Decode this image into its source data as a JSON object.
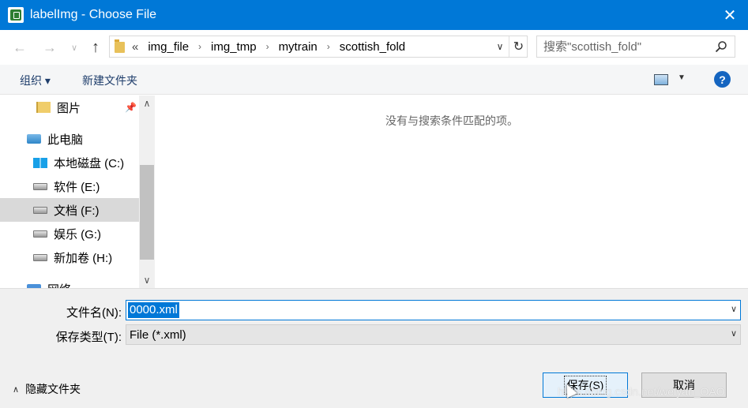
{
  "window": {
    "title": "labelImg - Choose File",
    "close_glyph": "✕"
  },
  "nav": {
    "back_glyph": "←",
    "forward_glyph": "→",
    "recent_glyph": "∨",
    "up_glyph": "↑",
    "overflow": "«",
    "breadcrumbs": [
      "img_file",
      "img_tmp",
      "mytrain",
      "scottish_fold"
    ],
    "separator": "›",
    "dropdown_glyph": "∨",
    "refresh_glyph": "↻"
  },
  "search": {
    "placeholder": "搜索\"scottish_fold\"",
    "icon": "search-icon"
  },
  "toolbar": {
    "organize": "组织 ▾",
    "new_folder": "新建文件夹",
    "view_dropdown": "▼",
    "help": "?"
  },
  "sidebar": {
    "items": [
      {
        "label": "图片",
        "icon": "pictures-folder-icon",
        "pinned": true
      },
      {
        "label": "此电脑",
        "icon": "computer-icon"
      },
      {
        "label": "本地磁盘 (C:)",
        "icon": "windows-drive-icon"
      },
      {
        "label": "软件 (E:)",
        "icon": "drive-icon"
      },
      {
        "label": "文档 (F:)",
        "icon": "drive-icon",
        "selected": true
      },
      {
        "label": "娱乐 (G:)",
        "icon": "drive-icon"
      },
      {
        "label": "新加卷 (H:)",
        "icon": "drive-icon"
      },
      {
        "label": "网络",
        "icon": "network-icon"
      }
    ],
    "pin_glyph": "📌",
    "scroll_up": "∧",
    "scroll_down": "∨"
  },
  "content": {
    "empty_message": "没有与搜索条件匹配的项。"
  },
  "form": {
    "filename_label": "文件名(N):",
    "filename_value": "0000.xml",
    "filetype_label": "保存类型(T):",
    "filetype_value": "File (*.xml)",
    "dropdown_glyph": "∨"
  },
  "footer": {
    "hide_folders": "隐藏文件夹",
    "chevron": "∧",
    "save": "保存(S)",
    "cancel": "取消",
    "watermark": "https://blog.csdn.net/weiyan_OAO"
  },
  "colors": {
    "titlebar": "#0078d7",
    "selection": "#0078d7",
    "help": "#1565c0"
  }
}
